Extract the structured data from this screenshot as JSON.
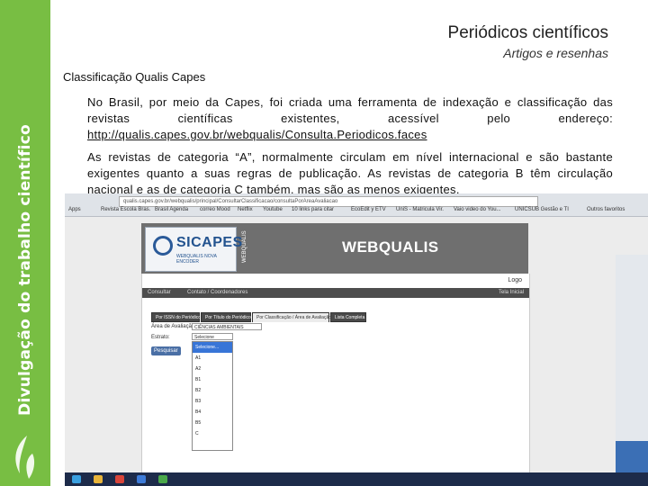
{
  "sidebar": {
    "vertical_title": "Divulgação do trabalho científico"
  },
  "header": {
    "title": "Periódicos científicos",
    "subtitle": "Artigos e resenhas"
  },
  "section_heading": "Classificação Qualis Capes",
  "paragraphs": {
    "p1_text": "No Brasil, por meio da Capes, foi criada uma ferramenta de indexação e classificação das revistas científicas existentes, acessível pelo endereço: ",
    "p1_link": "http://qualis.capes.gov.br/webqualis/Consulta.Periodicos.faces",
    "p2_text": "As revistas de categoria “A”, normalmente circulam em nível internacional e são bastante exigentes quanto a suas regras de publicação. As revistas de categoria B têm circulação nacional e as de categoria C também, mas são as menos exigentes."
  },
  "screenshot": {
    "address": "qualis.capes.gov.br/webqualis/principal/ConsultarClassificacao/consultaPorAreaAvaliacao",
    "bookmarks": [
      "Apps",
      "Revista Escola Bras.",
      "Brasil Agenda",
      "correo Mood",
      "Netflix",
      "Youtube",
      "10 links para citar",
      "EcoEdit y ETV",
      "UniS - Matricula Vir.",
      "Vaio video do You...",
      "UNICSUB Gestão e TI",
      "Outros favoritos"
    ],
    "logo_word": "SICAPES",
    "logo_tag": "WEBQUALIS NOVA ENCODER",
    "banner_vertical_label": "WEBQUALIS",
    "banner_title": "WEBQUALIS",
    "logout": "Logo",
    "menu": {
      "left1": "Consultar",
      "left2": "Contato / Coordenadores",
      "right": "Tela Inicial"
    },
    "tabs": [
      "Por ISSN do Periódico",
      "Por Título do Periódico",
      "Por Classificação / Área de Avaliação",
      "Lista Completa"
    ],
    "form": {
      "area_label": "Área de Avaliação:",
      "area_value": "CIÊNCIAS AMBIENTAIS",
      "estrato_label": "Estrato:",
      "estrato_value": "Selecione",
      "search_button": "Pesquisar"
    },
    "dropdown_options": [
      "Selecione...",
      "A1",
      "A2",
      "B1",
      "B2",
      "B3",
      "B4",
      "B5",
      "C"
    ]
  },
  "colors": {
    "sidebar_green": "#78be43",
    "banner_gray": "#6f6f6f",
    "menu_dark": "#4d4d4d",
    "select_highlight": "#3875d7"
  }
}
